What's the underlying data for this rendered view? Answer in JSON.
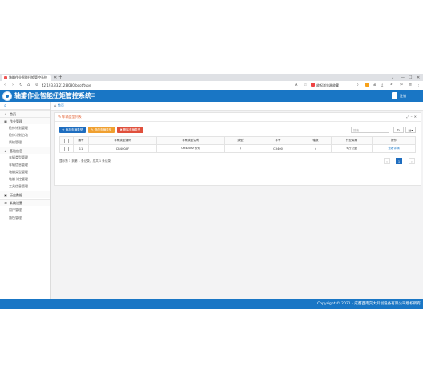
{
  "browser": {
    "tab_title": "轴瓣作业智能扭矩管控系统",
    "url": "42.193.33.212:8080/boot/type",
    "bookmark_label": "收起浏览器收藏"
  },
  "header": {
    "app_title": "轴瓣作业智能扭矩管控系统",
    "exit_label": "注销"
  },
  "sidebar": {
    "search_icon": "search-icon",
    "items": [
      {
        "label": "首页",
        "type": "group",
        "icon": "home-icon"
      },
      {
        "label": "作业管理",
        "type": "group",
        "icon": "table-icon"
      },
      {
        "label": "检修计划管理",
        "type": "sub"
      },
      {
        "label": "检修计划启动",
        "type": "sub"
      },
      {
        "label": "质检管理",
        "type": "sub"
      },
      {
        "label": "基础信息",
        "type": "group",
        "icon": "home-icon"
      },
      {
        "label": "车辆类型管理",
        "type": "sub"
      },
      {
        "label": "车辆信息管理",
        "type": "sub"
      },
      {
        "label": "轴瓣类型管理",
        "type": "sub"
      },
      {
        "label": "轴瓣卡控管理",
        "type": "sub"
      },
      {
        "label": "工具信息管理",
        "type": "sub"
      },
      {
        "label": "历史数据",
        "type": "group",
        "icon": "image-icon"
      },
      {
        "label": "系统设置",
        "type": "group",
        "icon": "wrench-icon"
      },
      {
        "label": "用户管理",
        "type": "sub"
      },
      {
        "label": "角色管理",
        "type": "sub"
      }
    ]
  },
  "breadcrumb": {
    "label": "首页"
  },
  "panel": {
    "title": "车辆类型列表",
    "buttons": {
      "add": "添加车辆类型",
      "edit": "修改车辆类型",
      "delete": "删除车辆类型"
    },
    "search_placeholder": "搜索",
    "table": {
      "headers": [
        "编号",
        "车辆类型编码",
        "车辆类型名称",
        "类型",
        "车号",
        "轴数",
        "作业周期",
        "操作"
      ],
      "rows": [
        [
          "11",
          "CR400AF",
          "CR400AF系列",
          "7",
          "CR400",
          "4",
          "6万公里",
          "查看详情"
        ]
      ]
    },
    "pagination": {
      "info": "显示第 1 到第 1 条记录，总共 1 条记录",
      "prev": "‹",
      "current": "1",
      "next": "›"
    }
  },
  "footer": {
    "copyright": "Copyright © 2021 - 成都西南交大科创设备有限公司版权所有"
  },
  "colors": {
    "primary": "#1976c5",
    "orange": "#f0a030",
    "red": "#e0503c",
    "panel_title": "#e05a2a"
  }
}
